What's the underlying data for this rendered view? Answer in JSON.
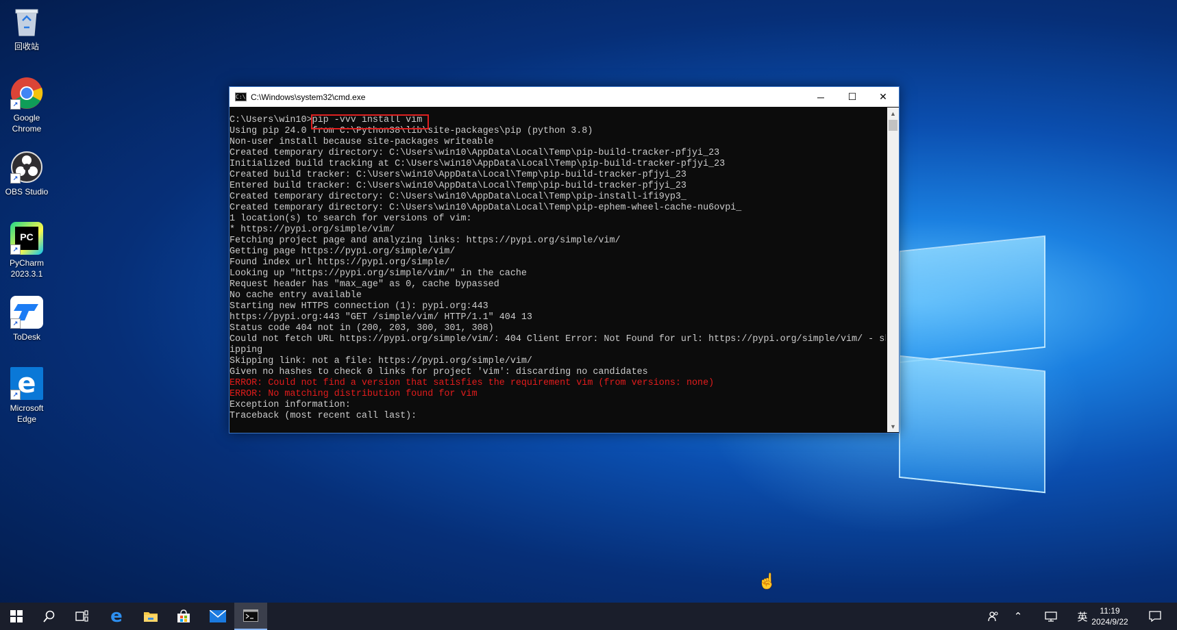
{
  "desktop": {
    "icons": [
      {
        "label": "回收站"
      },
      {
        "label": "Google\nChrome"
      },
      {
        "label": "OBS Studio"
      },
      {
        "label": "PyCharm\n2023.3.1"
      },
      {
        "label": "ToDesk"
      },
      {
        "label": "Microsoft\nEdge"
      }
    ]
  },
  "window": {
    "title": "C:\\Windows\\system32\\cmd.exe",
    "icon": "cmd-icon",
    "controls": {
      "minimize": "─",
      "maximize": "☐",
      "close": "✕"
    }
  },
  "console": {
    "lines": [
      {
        "text": "C:\\Users\\win10>pip -vvv install vim",
        "error": false
      },
      {
        "text": "Using pip 24.0 from C:\\Python38\\lib\\site-packages\\pip (python 3.8)",
        "error": false
      },
      {
        "text": "Non-user install because site-packages writeable",
        "error": false
      },
      {
        "text": "Created temporary directory: C:\\Users\\win10\\AppData\\Local\\Temp\\pip-build-tracker-pfjyi_23",
        "error": false
      },
      {
        "text": "Initialized build tracking at C:\\Users\\win10\\AppData\\Local\\Temp\\pip-build-tracker-pfjyi_23",
        "error": false
      },
      {
        "text": "Created build tracker: C:\\Users\\win10\\AppData\\Local\\Temp\\pip-build-tracker-pfjyi_23",
        "error": false
      },
      {
        "text": "Entered build tracker: C:\\Users\\win10\\AppData\\Local\\Temp\\pip-build-tracker-pfjyi_23",
        "error": false
      },
      {
        "text": "Created temporary directory: C:\\Users\\win10\\AppData\\Local\\Temp\\pip-install-ifi9yp3_",
        "error": false
      },
      {
        "text": "Created temporary directory: C:\\Users\\win10\\AppData\\Local\\Temp\\pip-ephem-wheel-cache-nu6ovpi_",
        "error": false
      },
      {
        "text": "1 location(s) to search for versions of vim:",
        "error": false
      },
      {
        "text": "* https://pypi.org/simple/vim/",
        "error": false
      },
      {
        "text": "Fetching project page and analyzing links: https://pypi.org/simple/vim/",
        "error": false
      },
      {
        "text": "Getting page https://pypi.org/simple/vim/",
        "error": false
      },
      {
        "text": "Found index url https://pypi.org/simple/",
        "error": false
      },
      {
        "text": "Looking up \"https://pypi.org/simple/vim/\" in the cache",
        "error": false
      },
      {
        "text": "Request header has \"max_age\" as 0, cache bypassed",
        "error": false
      },
      {
        "text": "No cache entry available",
        "error": false
      },
      {
        "text": "Starting new HTTPS connection (1): pypi.org:443",
        "error": false
      },
      {
        "text": "https://pypi.org:443 \"GET /simple/vim/ HTTP/1.1\" 404 13",
        "error": false
      },
      {
        "text": "Status code 404 not in (200, 203, 300, 301, 308)",
        "error": false
      },
      {
        "text": "Could not fetch URL https://pypi.org/simple/vim/: 404 Client Error: Not Found for url: https://pypi.org/simple/vim/ - sk",
        "error": false
      },
      {
        "text": "ipping",
        "error": false
      },
      {
        "text": "Skipping link: not a file: https://pypi.org/simple/vim/",
        "error": false
      },
      {
        "text": "Given no hashes to check 0 links for project 'vim': discarding no candidates",
        "error": false
      },
      {
        "text": "ERROR: Could not find a version that satisfies the requirement vim (from versions: none)",
        "error": true
      },
      {
        "text": "ERROR: No matching distribution found for vim",
        "error": true
      },
      {
        "text": "Exception information:",
        "error": false
      },
      {
        "text": "Traceback (most recent call last):",
        "error": false
      }
    ]
  },
  "taskbar": {
    "items": [
      {
        "name": "start-button",
        "icon": "windows-icon"
      },
      {
        "name": "search-button",
        "icon": "search-icon"
      },
      {
        "name": "task-view-button",
        "icon": "task-view-icon"
      },
      {
        "name": "taskbar-edge",
        "icon": "edge-icon"
      },
      {
        "name": "taskbar-file-explorer",
        "icon": "folder-icon"
      },
      {
        "name": "taskbar-store",
        "icon": "store-icon"
      },
      {
        "name": "taskbar-mail",
        "icon": "mail-icon"
      },
      {
        "name": "taskbar-cmd",
        "icon": "cmd-icon"
      }
    ],
    "tray": {
      "ime": "英",
      "time": "11:19",
      "date": "2024/9/22"
    }
  },
  "colors": {
    "error_text": "#e31c1c",
    "console_text": "#cccccc",
    "console_bg": "#0c0c0c",
    "highlight_box": "#e02020",
    "taskbar_bg": "#1a1e2b"
  }
}
